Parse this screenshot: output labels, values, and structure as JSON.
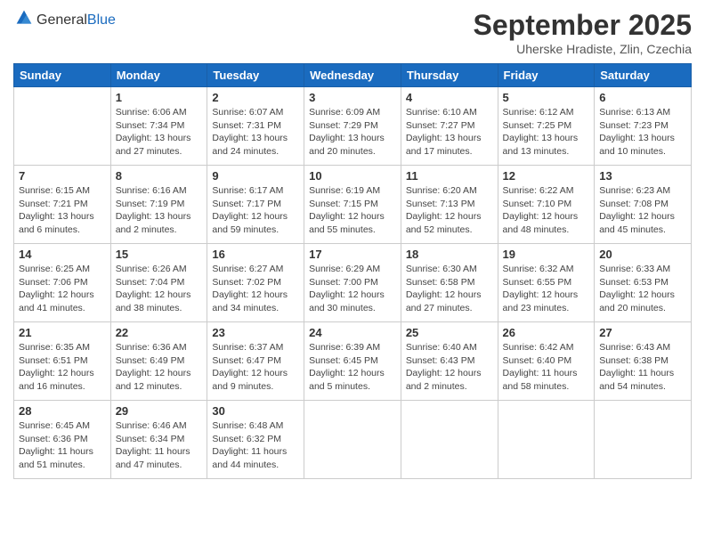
{
  "header": {
    "logo_general": "General",
    "logo_blue": "Blue",
    "month": "September 2025",
    "location": "Uherske Hradiste, Zlin, Czechia"
  },
  "weekdays": [
    "Sunday",
    "Monday",
    "Tuesday",
    "Wednesday",
    "Thursday",
    "Friday",
    "Saturday"
  ],
  "weeks": [
    [
      {
        "day": "",
        "info": ""
      },
      {
        "day": "1",
        "info": "Sunrise: 6:06 AM\nSunset: 7:34 PM\nDaylight: 13 hours\nand 27 minutes."
      },
      {
        "day": "2",
        "info": "Sunrise: 6:07 AM\nSunset: 7:31 PM\nDaylight: 13 hours\nand 24 minutes."
      },
      {
        "day": "3",
        "info": "Sunrise: 6:09 AM\nSunset: 7:29 PM\nDaylight: 13 hours\nand 20 minutes."
      },
      {
        "day": "4",
        "info": "Sunrise: 6:10 AM\nSunset: 7:27 PM\nDaylight: 13 hours\nand 17 minutes."
      },
      {
        "day": "5",
        "info": "Sunrise: 6:12 AM\nSunset: 7:25 PM\nDaylight: 13 hours\nand 13 minutes."
      },
      {
        "day": "6",
        "info": "Sunrise: 6:13 AM\nSunset: 7:23 PM\nDaylight: 13 hours\nand 10 minutes."
      }
    ],
    [
      {
        "day": "7",
        "info": "Sunrise: 6:15 AM\nSunset: 7:21 PM\nDaylight: 13 hours\nand 6 minutes."
      },
      {
        "day": "8",
        "info": "Sunrise: 6:16 AM\nSunset: 7:19 PM\nDaylight: 13 hours\nand 2 minutes."
      },
      {
        "day": "9",
        "info": "Sunrise: 6:17 AM\nSunset: 7:17 PM\nDaylight: 12 hours\nand 59 minutes."
      },
      {
        "day": "10",
        "info": "Sunrise: 6:19 AM\nSunset: 7:15 PM\nDaylight: 12 hours\nand 55 minutes."
      },
      {
        "day": "11",
        "info": "Sunrise: 6:20 AM\nSunset: 7:13 PM\nDaylight: 12 hours\nand 52 minutes."
      },
      {
        "day": "12",
        "info": "Sunrise: 6:22 AM\nSunset: 7:10 PM\nDaylight: 12 hours\nand 48 minutes."
      },
      {
        "day": "13",
        "info": "Sunrise: 6:23 AM\nSunset: 7:08 PM\nDaylight: 12 hours\nand 45 minutes."
      }
    ],
    [
      {
        "day": "14",
        "info": "Sunrise: 6:25 AM\nSunset: 7:06 PM\nDaylight: 12 hours\nand 41 minutes."
      },
      {
        "day": "15",
        "info": "Sunrise: 6:26 AM\nSunset: 7:04 PM\nDaylight: 12 hours\nand 38 minutes."
      },
      {
        "day": "16",
        "info": "Sunrise: 6:27 AM\nSunset: 7:02 PM\nDaylight: 12 hours\nand 34 minutes."
      },
      {
        "day": "17",
        "info": "Sunrise: 6:29 AM\nSunset: 7:00 PM\nDaylight: 12 hours\nand 30 minutes."
      },
      {
        "day": "18",
        "info": "Sunrise: 6:30 AM\nSunset: 6:58 PM\nDaylight: 12 hours\nand 27 minutes."
      },
      {
        "day": "19",
        "info": "Sunrise: 6:32 AM\nSunset: 6:55 PM\nDaylight: 12 hours\nand 23 minutes."
      },
      {
        "day": "20",
        "info": "Sunrise: 6:33 AM\nSunset: 6:53 PM\nDaylight: 12 hours\nand 20 minutes."
      }
    ],
    [
      {
        "day": "21",
        "info": "Sunrise: 6:35 AM\nSunset: 6:51 PM\nDaylight: 12 hours\nand 16 minutes."
      },
      {
        "day": "22",
        "info": "Sunrise: 6:36 AM\nSunset: 6:49 PM\nDaylight: 12 hours\nand 12 minutes."
      },
      {
        "day": "23",
        "info": "Sunrise: 6:37 AM\nSunset: 6:47 PM\nDaylight: 12 hours\nand 9 minutes."
      },
      {
        "day": "24",
        "info": "Sunrise: 6:39 AM\nSunset: 6:45 PM\nDaylight: 12 hours\nand 5 minutes."
      },
      {
        "day": "25",
        "info": "Sunrise: 6:40 AM\nSunset: 6:43 PM\nDaylight: 12 hours\nand 2 minutes."
      },
      {
        "day": "26",
        "info": "Sunrise: 6:42 AM\nSunset: 6:40 PM\nDaylight: 11 hours\nand 58 minutes."
      },
      {
        "day": "27",
        "info": "Sunrise: 6:43 AM\nSunset: 6:38 PM\nDaylight: 11 hours\nand 54 minutes."
      }
    ],
    [
      {
        "day": "28",
        "info": "Sunrise: 6:45 AM\nSunset: 6:36 PM\nDaylight: 11 hours\nand 51 minutes."
      },
      {
        "day": "29",
        "info": "Sunrise: 6:46 AM\nSunset: 6:34 PM\nDaylight: 11 hours\nand 47 minutes."
      },
      {
        "day": "30",
        "info": "Sunrise: 6:48 AM\nSunset: 6:32 PM\nDaylight: 11 hours\nand 44 minutes."
      },
      {
        "day": "",
        "info": ""
      },
      {
        "day": "",
        "info": ""
      },
      {
        "day": "",
        "info": ""
      },
      {
        "day": "",
        "info": ""
      }
    ]
  ]
}
